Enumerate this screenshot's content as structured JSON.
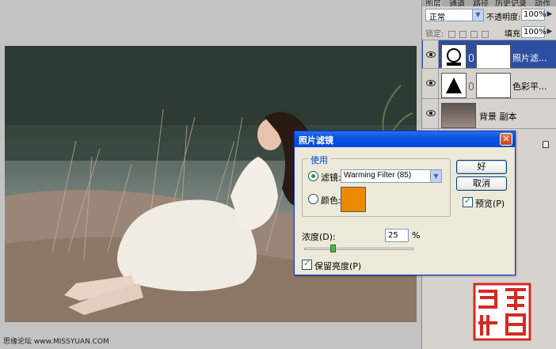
{
  "layers_panel": {
    "tabs": [
      "图层",
      "通道",
      "路径",
      "历史记录",
      "动作"
    ],
    "blend_mode": "正常",
    "opacity_label": "不透明度:",
    "opacity_value": "100%",
    "lock_label": "锁定:",
    "fill_label": "填充:",
    "fill_value": "100%",
    "layers": [
      {
        "name": "照片滤...",
        "selected": true,
        "type": "adjustment"
      },
      {
        "name": "色彩平...",
        "selected": false,
        "type": "adjustment"
      },
      {
        "name": "背景 副本",
        "selected": false,
        "type": "image"
      },
      {
        "name": "",
        "selected": false,
        "type": "background-locked"
      }
    ]
  },
  "dialog": {
    "title": "照片滤镜",
    "group_label": "使用",
    "filter_radio_label": "滤镜:",
    "filter_value": "Warming Filter (85)",
    "color_radio_label": "颜色:",
    "color_value": "#ec8a00",
    "ok_label": "好",
    "cancel_label": "取消",
    "preview_label": "预览(P)",
    "preview_checked": true,
    "density_label": "浓度(D):",
    "density_value": "25",
    "density_unit": "%",
    "density_level": 25,
    "preserve_label": "保留亮度(P)",
    "preserve_checked": true
  },
  "footer": {
    "watermark": "思缘论坛 www.MISSYUAN.COM"
  },
  "seal": {
    "text": "巢心相印",
    "color": "#d42a24"
  },
  "colors": {
    "accent": "#0a54e4",
    "selected_layer": "#2c4fa0"
  }
}
